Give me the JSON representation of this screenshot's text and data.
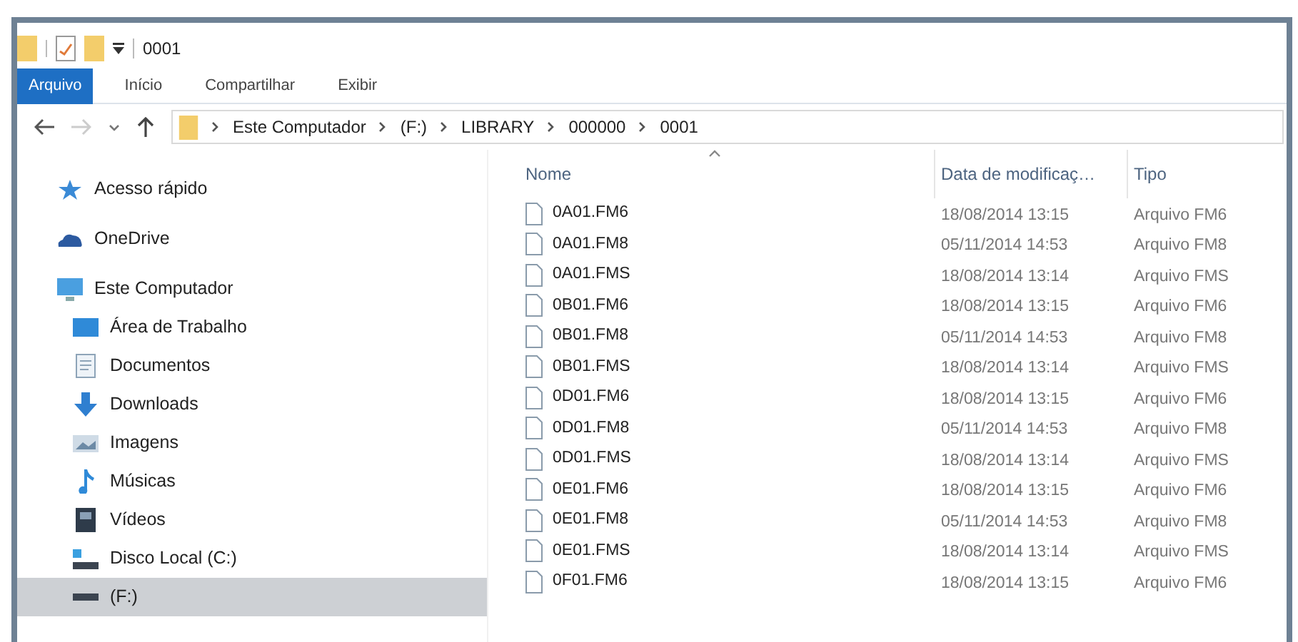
{
  "window": {
    "title": "0001"
  },
  "ribbon_tabs": [
    {
      "label": "Arquivo",
      "selected": true
    },
    {
      "label": "Início",
      "selected": false
    },
    {
      "label": "Compartilhar",
      "selected": false
    },
    {
      "label": "Exibir",
      "selected": false
    }
  ],
  "navigation": {
    "back": {
      "disabled": false
    },
    "forward": {
      "disabled": true
    }
  },
  "address_bar": {
    "segments": [
      "Este Computador",
      "(F:)",
      "LIBRARY",
      "000000",
      "0001"
    ]
  },
  "sidebar": {
    "items": [
      {
        "label": "Acesso rápido",
        "kind": "star",
        "selected": false
      },
      {
        "label": "OneDrive",
        "kind": "cloud",
        "selected": false
      },
      {
        "label": "Este Computador",
        "kind": "computer",
        "selected": false,
        "children": [
          {
            "label": "Área de Trabalho",
            "kind": "desktop",
            "selected": false
          },
          {
            "label": "Documentos",
            "kind": "documents",
            "selected": false
          },
          {
            "label": "Downloads",
            "kind": "downloads",
            "selected": false
          },
          {
            "label": "Imagens",
            "kind": "images",
            "selected": false
          },
          {
            "label": "Músicas",
            "kind": "music",
            "selected": false
          },
          {
            "label": "Vídeos",
            "kind": "videos",
            "selected": false
          },
          {
            "label": "Disco Local (C:)",
            "kind": "disk",
            "selected": false
          },
          {
            "label": "(F:)",
            "kind": "drive",
            "selected": true
          }
        ]
      }
    ]
  },
  "file_list": {
    "columns": [
      {
        "label": "Nome",
        "sorted": true
      },
      {
        "label": "Data de modificaç…",
        "sorted": false
      },
      {
        "label": "Tipo",
        "sorted": false
      }
    ],
    "rows": [
      {
        "name": "0A01.FM6",
        "modified": "18/08/2014 13:15",
        "type": "Arquivo FM6"
      },
      {
        "name": "0A01.FM8",
        "modified": "05/11/2014 14:53",
        "type": "Arquivo FM8"
      },
      {
        "name": "0A01.FMS",
        "modified": "18/08/2014 13:14",
        "type": "Arquivo FMS"
      },
      {
        "name": "0B01.FM6",
        "modified": "18/08/2014 13:15",
        "type": "Arquivo FM6"
      },
      {
        "name": "0B01.FM8",
        "modified": "05/11/2014 14:53",
        "type": "Arquivo FM8"
      },
      {
        "name": "0B01.FMS",
        "modified": "18/08/2014 13:14",
        "type": "Arquivo FMS"
      },
      {
        "name": "0D01.FM6",
        "modified": "18/08/2014 13:15",
        "type": "Arquivo FM6"
      },
      {
        "name": "0D01.FM8",
        "modified": "05/11/2014 14:53",
        "type": "Arquivo FM8"
      },
      {
        "name": "0D01.FMS",
        "modified": "18/08/2014 13:14",
        "type": "Arquivo FMS"
      },
      {
        "name": "0E01.FM6",
        "modified": "18/08/2014 13:15",
        "type": "Arquivo FM6"
      },
      {
        "name": "0E01.FM8",
        "modified": "05/11/2014 14:53",
        "type": "Arquivo FM8"
      },
      {
        "name": "0E01.FMS",
        "modified": "18/08/2014 13:14",
        "type": "Arquivo FMS"
      },
      {
        "name": "0F01.FM6",
        "modified": "18/08/2014 13:15",
        "type": "Arquivo FM6"
      }
    ]
  }
}
